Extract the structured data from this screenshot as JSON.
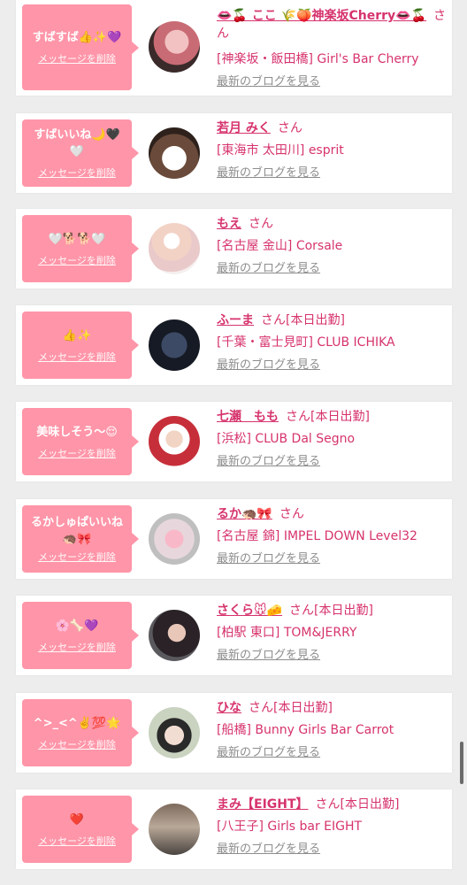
{
  "items": [
    {
      "message": "すばすば👍✨💜",
      "delete_label": "メッセージを削除",
      "name": "👄🍒 ここ 🌾🍑神楽坂Cherry👄🍒",
      "san": "さん",
      "status": "",
      "shop": "[神楽坂・飯田橋] Girl's Bar Cherry",
      "blog": "最新のブログを見る"
    },
    {
      "message": "すばいいね🌙🖤🤍",
      "delete_label": "メッセージを削除",
      "name": "若月 みく",
      "san": "さん",
      "status": "",
      "shop": "[東海市 太田川] esprit",
      "blog": "最新のブログを見る"
    },
    {
      "message": "🤍🐕🐕🤍",
      "delete_label": "メッセージを削除",
      "name": "もえ",
      "san": "さん",
      "status": "",
      "shop": "[名古屋 金山] Corsale",
      "blog": "最新のブログを見る"
    },
    {
      "message": "👍✨",
      "delete_label": "メッセージを削除",
      "name": "ふーま",
      "san": "さん",
      "status": "[本日出勤]",
      "shop": "[千葉・富士見町] CLUB ICHIKA",
      "blog": "最新のブログを見る"
    },
    {
      "message": "美味しそう〜😌",
      "delete_label": "メッセージを削除",
      "name": "七瀬　もも",
      "san": "さん",
      "status": "[本日出勤]",
      "shop": "[浜松] CLUB Dal Segno",
      "blog": "最新のブログを見る"
    },
    {
      "message": "るかしゅぱいいね🦔🎀",
      "delete_label": "メッセージを削除",
      "name": "るか🦔🎀",
      "san": "さん",
      "status": "",
      "shop": "[名古屋 錦] IMPEL DOWN Level32",
      "blog": "最新のブログを見る"
    },
    {
      "message": "🌸🦴💜",
      "delete_label": "メッセージを削除",
      "name": "さくら🐭🧀",
      "san": "さん",
      "status": "[本日出勤]",
      "shop": "[柏駅 東口] TOM&JERRY",
      "blog": "最新のブログを見る"
    },
    {
      "message": "^>_<^✌️💯🌟",
      "delete_label": "メッセージを削除",
      "name": "ひな",
      "san": "さん",
      "status": "[本日出勤]",
      "shop": "[船橋] Bunny Girls Bar Carrot",
      "blog": "最新のブログを見る"
    },
    {
      "message": "❤️",
      "delete_label": "メッセージを削除",
      "name": "まみ【EIGHT】",
      "san": "さん",
      "status": "[本日出勤]",
      "shop": "[八王子] Girls bar EIGHT",
      "blog": "最新のブログを見る"
    }
  ],
  "colors": {
    "bubble": "#ff95a8",
    "accent": "#d6336c",
    "link_gray": "#8d8d8d",
    "background": "#ededed"
  }
}
